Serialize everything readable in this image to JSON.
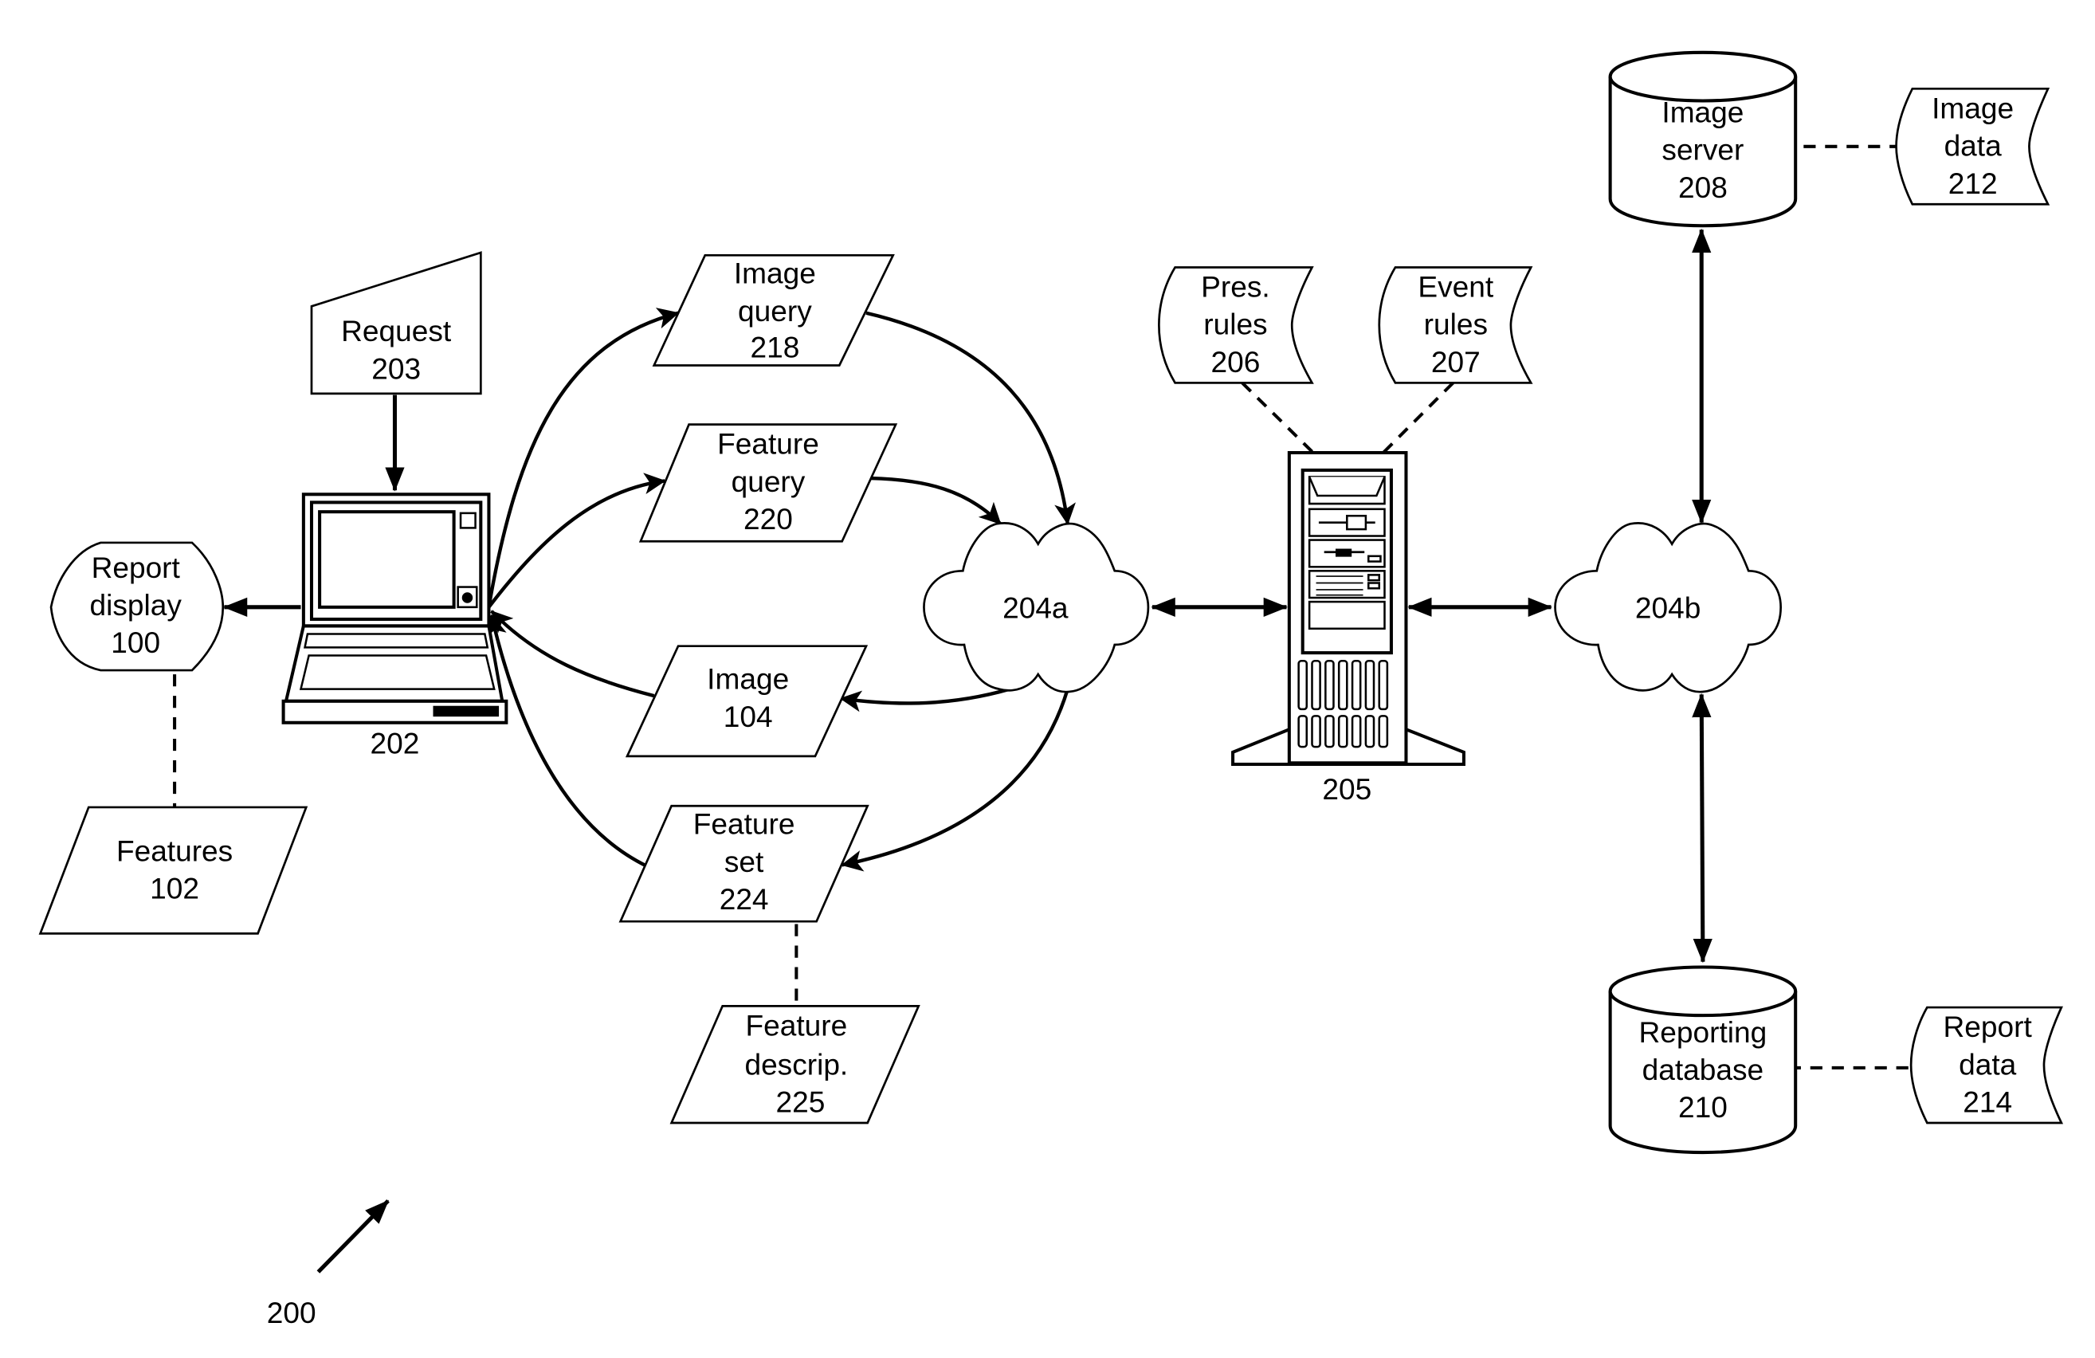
{
  "figure": {
    "reference_label": "200",
    "colors": {
      "ink": "#000000",
      "background": "#ffffff"
    }
  },
  "nodes": {
    "request": {
      "lines": [
        "Request",
        "203"
      ]
    },
    "laptop": {
      "label": "202"
    },
    "report_display": {
      "lines": [
        "Report",
        "display",
        "100"
      ]
    },
    "features": {
      "lines": [
        "Features",
        "102"
      ]
    },
    "image_query": {
      "lines": [
        "Image",
        "query",
        "218"
      ]
    },
    "feature_query": {
      "lines": [
        "Feature",
        "query",
        "220"
      ]
    },
    "image": {
      "lines": [
        "Image",
        "104"
      ]
    },
    "feature_set": {
      "lines": [
        "Feature",
        "set",
        "224"
      ]
    },
    "feature_descrip": {
      "lines": [
        "Feature",
        "descrip.",
        "225"
      ]
    },
    "network_a": {
      "label": "204a"
    },
    "server": {
      "label": "205"
    },
    "pres_rules": {
      "lines": [
        "Pres.",
        "rules",
        "206"
      ]
    },
    "event_rules": {
      "lines": [
        "Event",
        "rules",
        "207"
      ]
    },
    "network_b": {
      "label": "204b"
    },
    "image_server": {
      "lines": [
        "Image",
        "server",
        "208"
      ]
    },
    "image_data": {
      "lines": [
        "Image",
        "data",
        "212"
      ]
    },
    "reporting_database": {
      "lines": [
        "Reporting",
        "database",
        "210"
      ]
    },
    "report_data": {
      "lines": [
        "Report",
        "data",
        "214"
      ]
    }
  },
  "edges": [
    {
      "from": "request",
      "to": "laptop",
      "style": "solid-arrow"
    },
    {
      "from": "laptop",
      "to": "report_display",
      "style": "solid-arrow"
    },
    {
      "from": "report_display",
      "to": "features",
      "style": "dashed"
    },
    {
      "from": "laptop",
      "to": "image_query",
      "style": "solid-arrow"
    },
    {
      "from": "image_query",
      "to": "network_a",
      "style": "solid-arrow"
    },
    {
      "from": "laptop",
      "to": "feature_query",
      "style": "solid-arrow"
    },
    {
      "from": "feature_query",
      "to": "network_a",
      "style": "solid-arrow"
    },
    {
      "from": "network_a",
      "to": "image",
      "style": "solid-arrow"
    },
    {
      "from": "image",
      "to": "laptop",
      "style": "solid-arrow"
    },
    {
      "from": "network_a",
      "to": "feature_set",
      "style": "solid-arrow"
    },
    {
      "from": "feature_set",
      "to": "laptop",
      "style": "solid-arrow"
    },
    {
      "from": "feature_set",
      "to": "feature_descrip",
      "style": "dashed"
    },
    {
      "from": "network_a",
      "to": "server",
      "style": "double-arrow"
    },
    {
      "from": "pres_rules",
      "to": "server",
      "style": "dashed"
    },
    {
      "from": "event_rules",
      "to": "server",
      "style": "dashed"
    },
    {
      "from": "server",
      "to": "network_b",
      "style": "double-arrow"
    },
    {
      "from": "network_b",
      "to": "image_server",
      "style": "double-arrow"
    },
    {
      "from": "image_server",
      "to": "image_data",
      "style": "dashed"
    },
    {
      "from": "network_b",
      "to": "reporting_database",
      "style": "double-arrow"
    },
    {
      "from": "reporting_database",
      "to": "report_data",
      "style": "dashed"
    }
  ]
}
